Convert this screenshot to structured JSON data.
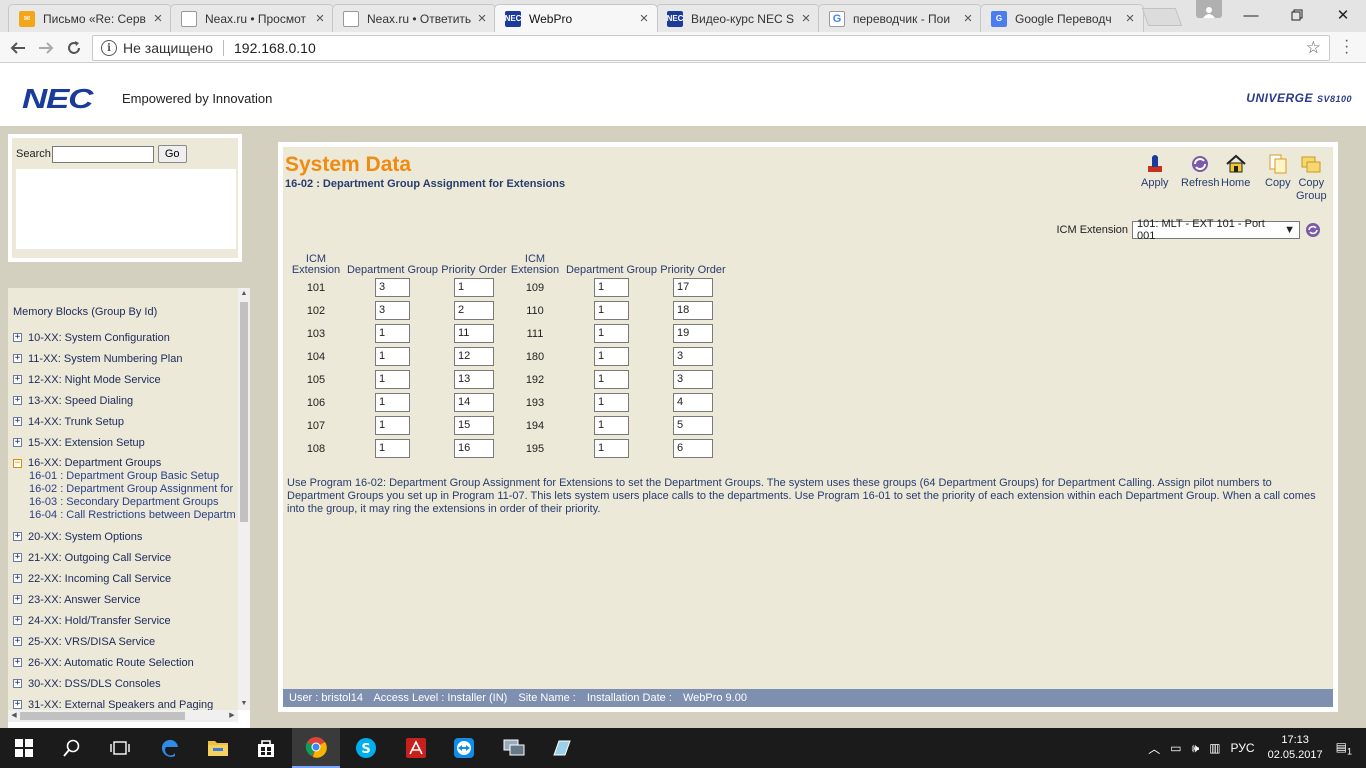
{
  "browser": {
    "tabs": [
      {
        "title": "Письмо «Re: Серв",
        "fav_color": "#f2a71b",
        "fav_text": "✉"
      },
      {
        "title": "Neax.ru • Просмот",
        "fav_color": "#ffffff",
        "fav_text": ""
      },
      {
        "title": "Neax.ru • Ответить",
        "fav_color": "#ffffff",
        "fav_text": ""
      },
      {
        "title": "WebPro",
        "fav_color": "#1a3a9c",
        "fav_text": "NEC"
      },
      {
        "title": "Видео-курс NEC S",
        "fav_color": "#1a3a9c",
        "fav_text": "NEC"
      },
      {
        "title": "переводчик - Пои",
        "fav_color": "#ffffff",
        "fav_text": "G"
      },
      {
        "title": "Google Переводч",
        "fav_color": "#4a7ef0",
        "fav_text": "G"
      }
    ],
    "active_tab": 3,
    "not_secure": "Не защищено",
    "url": "192.168.0.10"
  },
  "header": {
    "logo": "NEC",
    "tagline": "Empowered by Innovation",
    "product": "UNIVERGE",
    "model": "SV8100"
  },
  "search": {
    "label": "Search",
    "value": "",
    "go": "Go"
  },
  "tree": {
    "title": "Memory Blocks (Group By Id)",
    "items": [
      {
        "label": "10-XX: System Configuration",
        "open": false
      },
      {
        "label": "11-XX: System Numbering Plan",
        "open": false
      },
      {
        "label": "12-XX: Night Mode Service",
        "open": false
      },
      {
        "label": "13-XX: Speed Dialing",
        "open": false
      },
      {
        "label": "14-XX: Trunk Setup",
        "open": false
      },
      {
        "label": "15-XX: Extension Setup",
        "open": false
      },
      {
        "label": "16-XX: Department Groups",
        "open": true,
        "children": [
          "16-01 : Department Group Basic Setup",
          "16-02 : Department Group Assignment for",
          "16-03 : Secondary Department Groups",
          "16-04 : Call Restrictions between Departm"
        ]
      },
      {
        "label": "20-XX: System Options",
        "open": false
      },
      {
        "label": "21-XX: Outgoing Call Service",
        "open": false
      },
      {
        "label": "22-XX: Incoming Call Service",
        "open": false
      },
      {
        "label": "23-XX: Answer Service",
        "open": false
      },
      {
        "label": "24-XX: Hold/Transfer Service",
        "open": false
      },
      {
        "label": "25-XX: VRS/DISA Service",
        "open": false
      },
      {
        "label": "26-XX: Automatic Route Selection",
        "open": false
      },
      {
        "label": "30-XX: DSS/DLS Consoles",
        "open": false
      },
      {
        "label": "31-XX: External Speakers and Paging",
        "open": false
      }
    ]
  },
  "main": {
    "title": "System Data",
    "subtitle": "16-02 : Department Group Assignment for Extensions",
    "toolbar": {
      "apply": "Apply",
      "refresh": "Refresh",
      "home": "Home",
      "copy": "Copy",
      "copy_group_1": "Copy",
      "copy_group_2": "Group"
    },
    "icm_label": "ICM Extension",
    "icm_selected": "101: MLT - EXT 101 - Port 001",
    "headers": {
      "icm_1": "ICM",
      "icm_2": "Extension",
      "dept": "Department Group",
      "prio": "Priority Order"
    },
    "rows_left": [
      {
        "ext": "101",
        "dept": "3",
        "prio": "1"
      },
      {
        "ext": "102",
        "dept": "3",
        "prio": "2"
      },
      {
        "ext": "103",
        "dept": "1",
        "prio": "11"
      },
      {
        "ext": "104",
        "dept": "1",
        "prio": "12"
      },
      {
        "ext": "105",
        "dept": "1",
        "prio": "13"
      },
      {
        "ext": "106",
        "dept": "1",
        "prio": "14"
      },
      {
        "ext": "107",
        "dept": "1",
        "prio": "15"
      },
      {
        "ext": "108",
        "dept": "1",
        "prio": "16"
      }
    ],
    "rows_right": [
      {
        "ext": "109",
        "dept": "1",
        "prio": "17"
      },
      {
        "ext": "110",
        "dept": "1",
        "prio": "18"
      },
      {
        "ext": "111",
        "dept": "1",
        "prio": "19"
      },
      {
        "ext": "180",
        "dept": "1",
        "prio": "3"
      },
      {
        "ext": "192",
        "dept": "1",
        "prio": "3"
      },
      {
        "ext": "193",
        "dept": "1",
        "prio": "4"
      },
      {
        "ext": "194",
        "dept": "1",
        "prio": "5"
      },
      {
        "ext": "195",
        "dept": "1",
        "prio": "6"
      }
    ],
    "help": "Use Program 16-02: Department Group Assignment for Extensions to set the Department Groups. The system uses these groups (64 Department Groups) for Department Calling. Assign pilot numbers to Department Groups you set up in Program 11-07. This lets system users place calls to the departments. Use Program 16-01 to set the priority of each extension within each Department Group. When a call comes into the group, it may ring the extensions in order of their priority.",
    "status": {
      "user": "User : bristol14",
      "access": "Access Level : Installer (IN)",
      "site": "Site Name :",
      "install": "Installation Date :",
      "version": "WebPro 9.00"
    }
  },
  "taskbar": {
    "lang": "РУС",
    "time": "17:13",
    "date": "02.05.2017",
    "notif_count": "1"
  },
  "colors": {
    "title_orange": "#f08a10",
    "nec_blue": "#1a3a9c",
    "panel_bg": "#ece9d8",
    "status_bar": "#7f8fb0"
  }
}
